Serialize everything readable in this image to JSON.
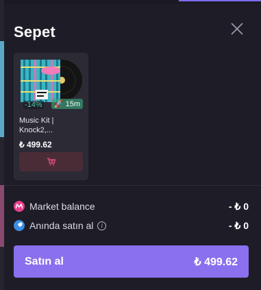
{
  "cart": {
    "title": "Sepet",
    "item": {
      "name_line1": "Music Kit |",
      "name_line2": "Knock2,...",
      "price": "₺ 499.62",
      "discount": "-14%",
      "time_badge": "15m"
    },
    "summary": [
      {
        "icon": "market-balance-icon",
        "label": "Market balance",
        "value": "- ₺ 0",
        "color": "#e83e8c"
      },
      {
        "icon": "rocket-icon",
        "label": "Anında satın al",
        "value": "- ₺ 0",
        "color": "#3a8ee6"
      }
    ],
    "buy": {
      "label": "Satın al",
      "amount": "₺ 499.62"
    }
  },
  "colors": {
    "accent": "#8a70ee",
    "panel": "#1e1d27",
    "card": "#2b2a35",
    "remove": "#4a2c36",
    "discount": "#49d3a3"
  }
}
